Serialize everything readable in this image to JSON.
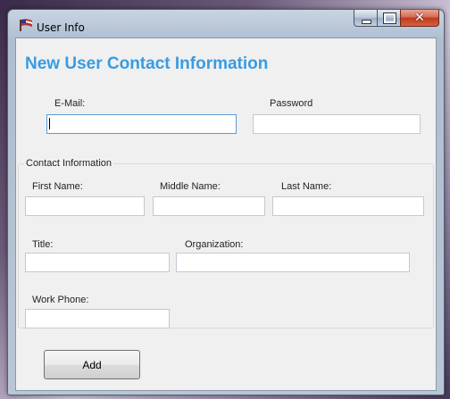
{
  "window": {
    "title": "User Info"
  },
  "form": {
    "heading": "New User Contact Information",
    "email_label": "E-Mail:",
    "email_value": "",
    "password_label": "Password",
    "password_value": "",
    "group_title": "Contact Information",
    "first_name_label": "First Name:",
    "first_name_value": "",
    "middle_name_label": "Middle Name:",
    "middle_name_value": "",
    "last_name_label": "Last Name:",
    "last_name_value": "",
    "title_label": "Title:",
    "title_value": "",
    "organization_label": "Organization:",
    "organization_value": "",
    "work_phone_label": "Work Phone:",
    "work_phone_value": "",
    "add_button": "Add"
  },
  "colors": {
    "heading": "#3a9be0",
    "close_button": "#c2391d",
    "focus_border": "#5a9bd6"
  },
  "icons": {
    "app": "flag-icon",
    "minimize": "minimize-icon",
    "maximize": "maximize-icon",
    "close": "close-icon"
  }
}
